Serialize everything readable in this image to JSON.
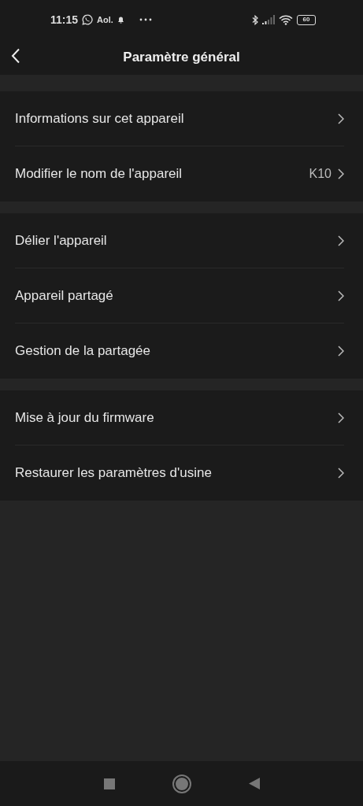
{
  "status_bar": {
    "time": "11:15",
    "carrier": "Aol.",
    "battery": "60"
  },
  "header": {
    "title": "Paramètre général"
  },
  "groups": [
    {
      "items": [
        {
          "label": "Informations sur cet appareil"
        },
        {
          "label": "Modifier le nom de l'appareil",
          "value": "K10"
        }
      ]
    },
    {
      "items": [
        {
          "label": "Délier l'appareil"
        },
        {
          "label": "Appareil partagé"
        },
        {
          "label": "Gestion de la partagée"
        }
      ]
    },
    {
      "items": [
        {
          "label": "Mise à jour du firmware"
        },
        {
          "label": "Restaurer les paramètres d'usine"
        }
      ]
    }
  ]
}
